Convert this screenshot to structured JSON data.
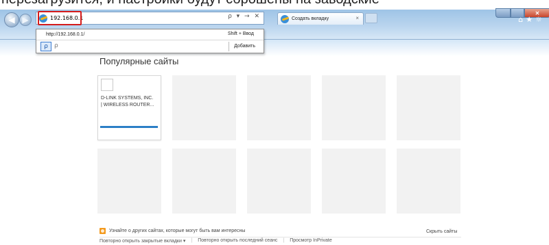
{
  "caption": "перезагрузится, и настройки будут сброшены на заводские",
  "browser": {
    "address": "192.168.0.1",
    "address_tools": "ρ ▾ → ✕",
    "tab_label": "Создать вкладку",
    "tab_close": "×",
    "right_icons": "⌂★☼",
    "back_glyph": "◀",
    "forward_glyph": "▶",
    "window_controls": {
      "close": "✕"
    }
  },
  "dropdown": {
    "suggestion_url": "http://192.168.0.1/",
    "shortcut": "Shift + Ввод",
    "add_label": "Добавить"
  },
  "page": {
    "heading": "Популярные сайты",
    "tiles": [
      {
        "title": "D-LINK SYSTEMS, INC.\n| WIRELESS ROUTER..."
      }
    ],
    "info_text": "Узнайте о других сайтах, которые могут быть вам интересны",
    "hide_sites": "Скрыть сайты",
    "footer_links": [
      "Повторно открыть закрытые вкладки ▾",
      "Повторно открыть последний сеанс",
      "Просмотр InPrivate"
    ]
  },
  "colors": {
    "accent": "#2b7fc6",
    "highlight": "#d41b1b",
    "info_icon": "#f39a1e"
  }
}
